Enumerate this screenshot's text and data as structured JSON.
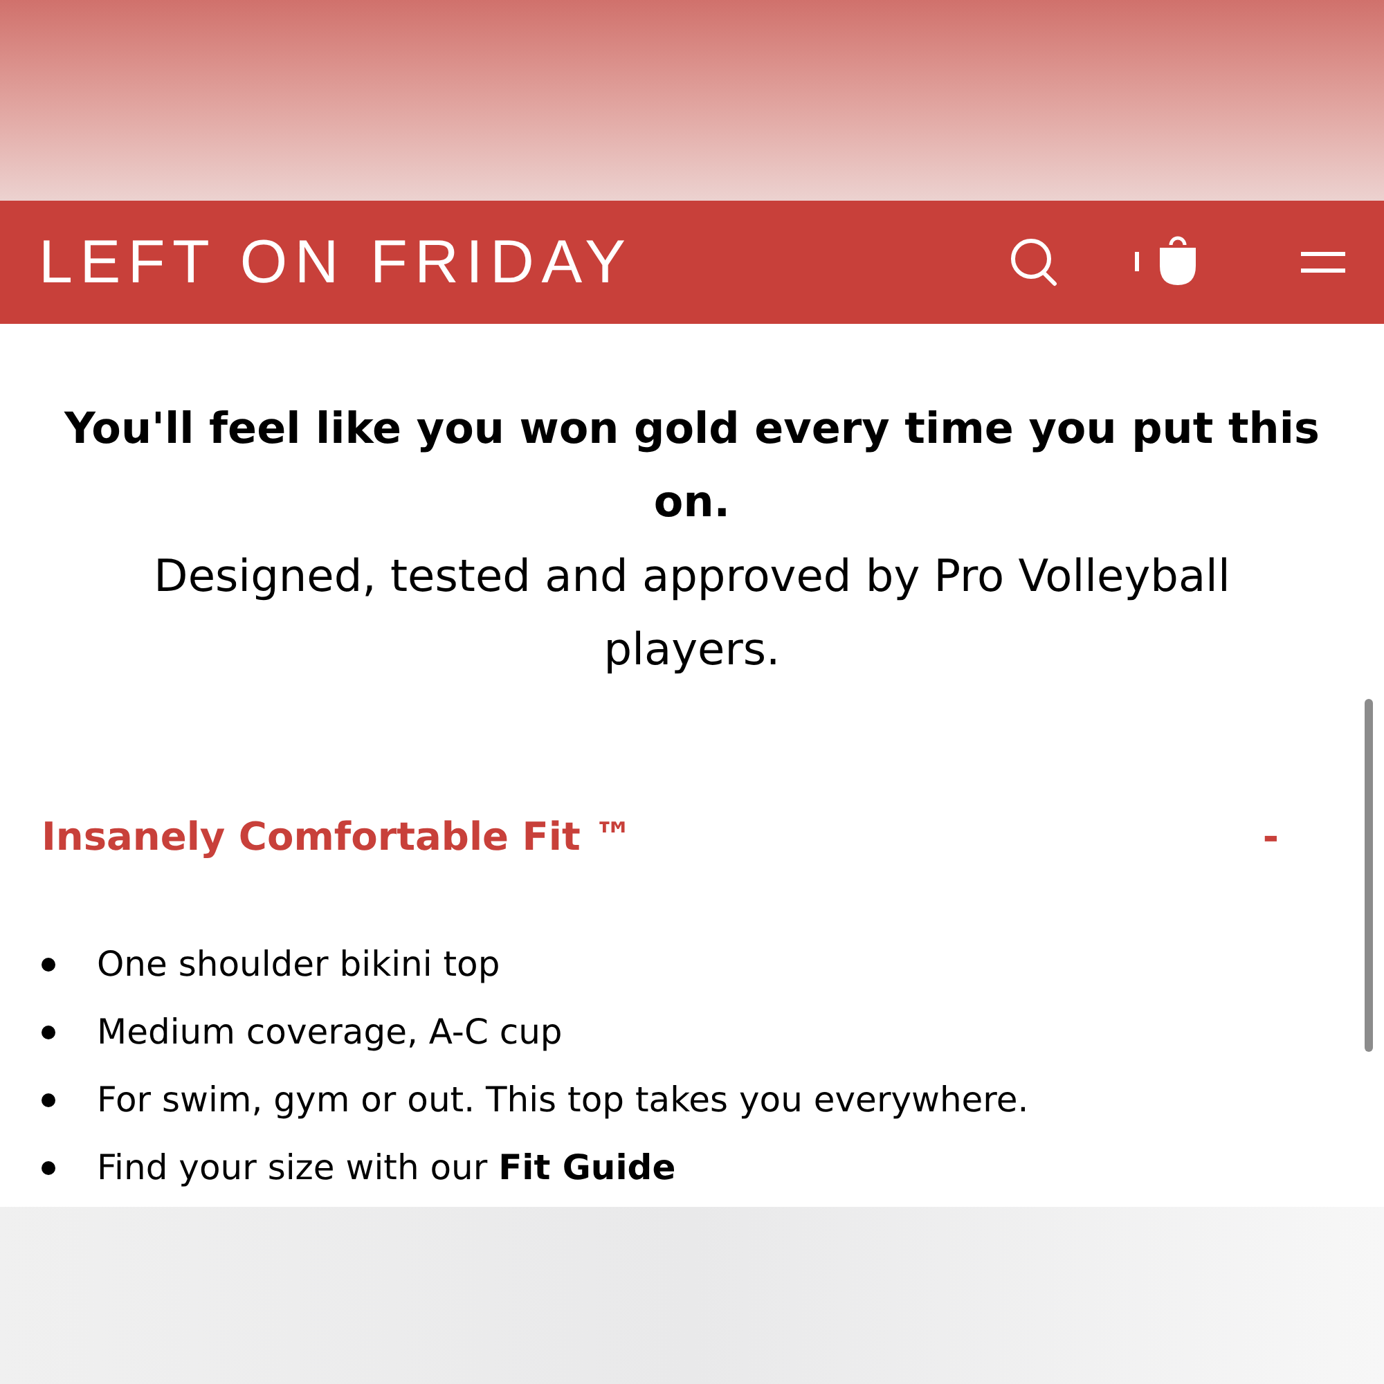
{
  "header": {
    "logo": "LEFT ON FRIDAY"
  },
  "intro": {
    "headline": "You'll feel like you won gold every time you put this on.",
    "subline": "Designed, tested and approved by Pro Volleyball players."
  },
  "section": {
    "title": "Insanely Comfortable Fit ™",
    "toggle": "-",
    "expanded": true,
    "bullets": [
      "One shoulder bikini top",
      "Medium coverage, A-C cup",
      "For swim, gym or out. This top takes you everywhere.",
      "Find your size with our **Fit Guide**"
    ]
  }
}
